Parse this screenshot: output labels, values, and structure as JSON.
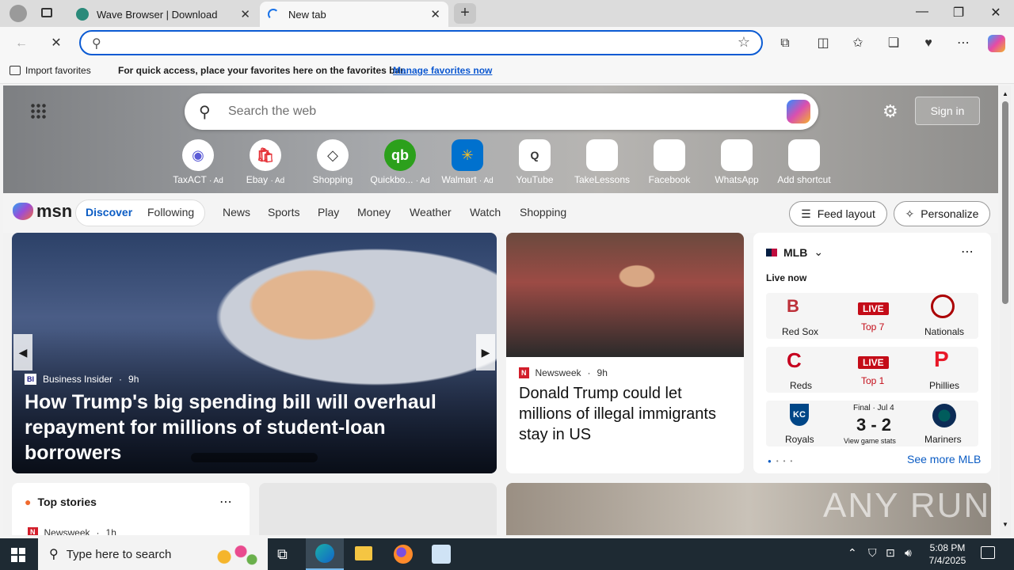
{
  "browser": {
    "tabs": [
      {
        "title": "Wave Browser | Download",
        "active": false
      },
      {
        "title": "New tab",
        "active": true
      }
    ],
    "address_value": "",
    "favorites_bar": {
      "import_label": "Import favorites",
      "message": "For quick access, place your favorites here on the favorites bar.",
      "manage_link": "Manage favorites now"
    }
  },
  "msn": {
    "search_placeholder": "Search the web",
    "sign_in": "Sign in",
    "shortcuts": [
      {
        "label": "TaxACT",
        "ad": "· Ad",
        "icon": "taxact-icon"
      },
      {
        "label": "Ebay",
        "ad": "· Ad",
        "icon": "ebay-icon"
      },
      {
        "label": "Shopping",
        "ad": "",
        "icon": "tag-icon"
      },
      {
        "label": "Quickbo...",
        "ad": "· Ad",
        "icon": "quickbooks-icon"
      },
      {
        "label": "Walmart",
        "ad": "· Ad",
        "icon": "walmart-icon"
      },
      {
        "label": "YouTube",
        "ad": "",
        "icon": "youtube-icon"
      },
      {
        "label": "TakeLessons",
        "ad": "",
        "icon": "blank-icon"
      },
      {
        "label": "Facebook",
        "ad": "",
        "icon": "blank-icon"
      },
      {
        "label": "WhatsApp",
        "ad": "",
        "icon": "blank-icon"
      },
      {
        "label": "Add shortcut",
        "ad": "",
        "icon": "plus-icon"
      }
    ],
    "logo": "msn",
    "pill_tabs": [
      "Discover",
      "Following"
    ],
    "nav_items": [
      "News",
      "Sports",
      "Play",
      "Money",
      "Weather",
      "Watch",
      "Shopping"
    ],
    "feed_layout": "Feed layout",
    "personalize": "Personalize",
    "hero_story": {
      "source": "Business Insider",
      "age": "9h",
      "headline": "How Trump's big spending bill will overhaul repayment for millions of student-loan borrowers"
    },
    "side_story": {
      "source": "Newsweek",
      "age": "9h",
      "headline": "Donald Trump could let millions of illegal immigrants stay in US"
    },
    "mlb": {
      "title": "MLB",
      "live_now": "Live now",
      "games": [
        {
          "home": "Red Sox",
          "away": "Nationals",
          "status": "LIVE",
          "detail": "Top 7"
        },
        {
          "home": "Reds",
          "away": "Phillies",
          "status": "LIVE",
          "detail": "Top 1"
        },
        {
          "home": "Royals",
          "away": "Mariners",
          "status": "Final · Jul 4",
          "detail": "3 - 2",
          "sub": "View game stats"
        }
      ],
      "see_more": "See more MLB"
    },
    "top_stories": {
      "title": "Top stories",
      "first_source": "Newsweek",
      "first_age": "1h"
    }
  },
  "taskbar": {
    "search_placeholder": "Type here to search",
    "time": "5:08 PM",
    "date": "7/4/2025"
  },
  "watermark": "ANY RUN"
}
